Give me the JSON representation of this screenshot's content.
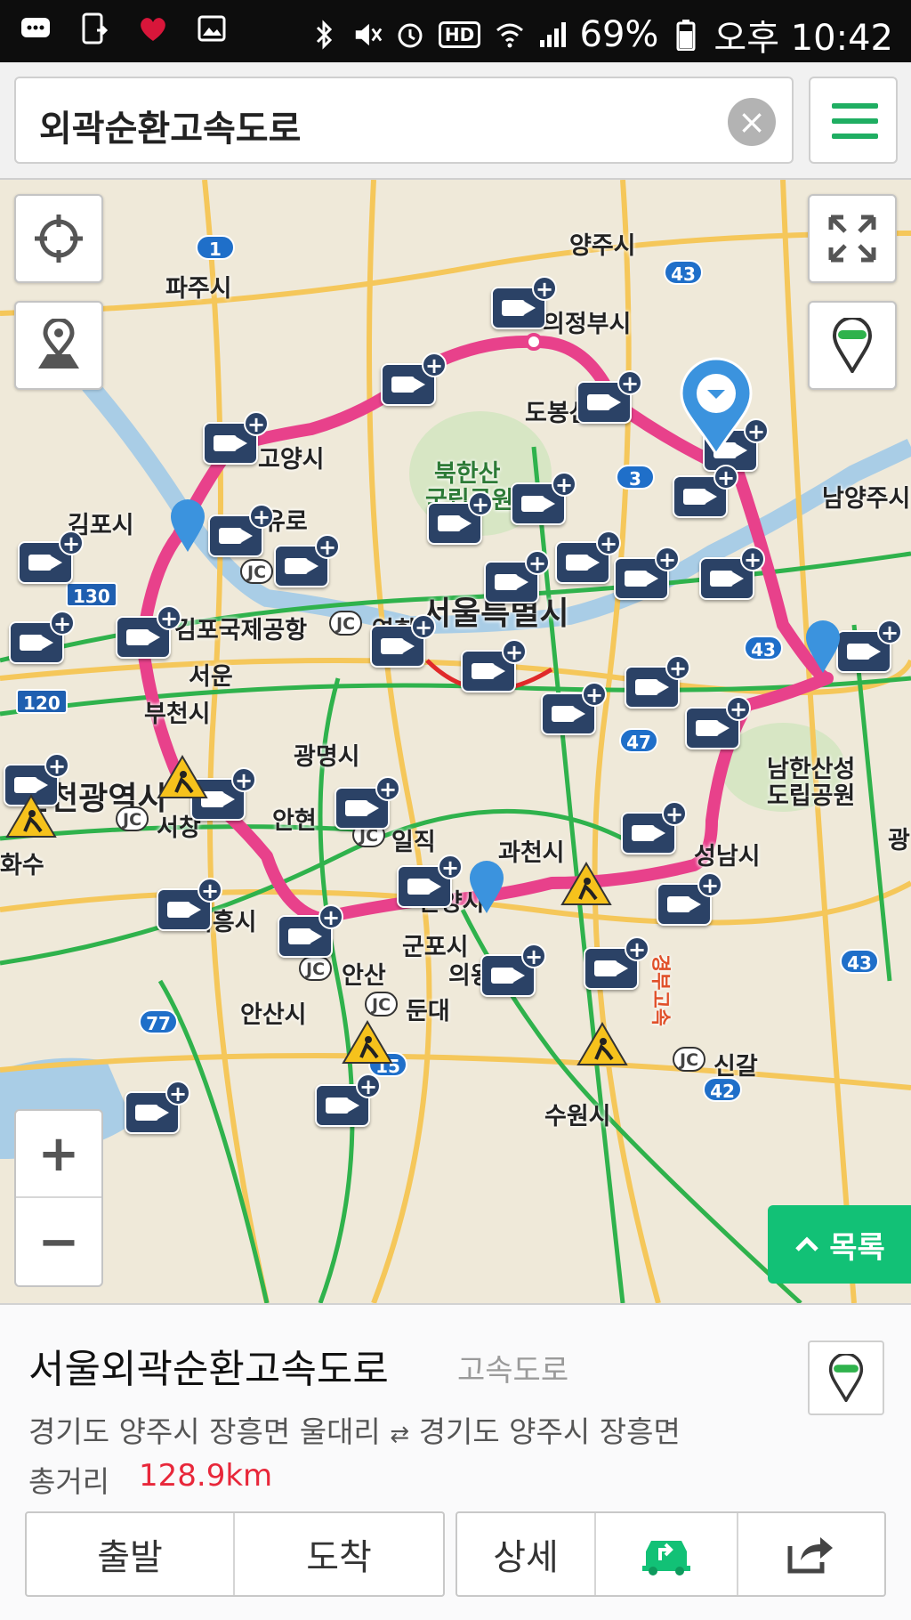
{
  "status_bar": {
    "left_icons": [
      "chat-icon",
      "phone-device-icon",
      "heart-icon",
      "image-icon"
    ],
    "right_icons": [
      "bluetooth-icon",
      "mute-icon",
      "alarm-icon",
      "hd-icon",
      "wifi-icon",
      "signal-icon"
    ],
    "hd_label": "HD",
    "battery": "69%",
    "time": "오후 10:42"
  },
  "search": {
    "query": "외곽순환고속도로",
    "clear_icon": "close-icon",
    "menu_icon": "hamburger-menu-icon"
  },
  "map": {
    "places": {
      "yangju": "양주시",
      "paju": "파주시",
      "uijeongbu": "의정부시",
      "dobong": "도봉산",
      "goyang": "고양시",
      "bukhansan": "북한산",
      "bukhansan2": "국립공원",
      "namyangju": "남양주시",
      "gimpo": "김포시",
      "yuro": "유로",
      "seoul": "서울특별시",
      "airport": "김포국제공항",
      "yeonhui": "연희",
      "seoun": "서운",
      "bucheon": "부천시",
      "gwangmyeong": "광명시",
      "namhansan": "남한산성",
      "namhansan2": "도립공원",
      "incheon": "인천광역시",
      "seochang": "서창",
      "anhyeon": "안현",
      "iljik": "일직",
      "gwacheon": "과천시",
      "seongnam": "성남시",
      "gwang": "광",
      "hwasu": "화수",
      "siheung": "시흥시",
      "anyang": "안양시",
      "gunpo": "군포시",
      "uiwang": "의왕",
      "ansan_jc": "안산",
      "dundae": "둔대",
      "ansan": "안산시",
      "singal": "신갈",
      "suwon": "수원시",
      "gyeongbu": "경부고속"
    },
    "shields": [
      "1",
      "43",
      "3",
      "130",
      "43",
      "120",
      "47",
      "43",
      "77",
      "15",
      "42"
    ],
    "jc_label": "JC",
    "list_button": "목록"
  },
  "panel": {
    "title": "서울외곽순환고속도로",
    "category": "고속도로",
    "route_from": "경기도 양주시 장흥면 울대리",
    "route_arrow": "⇄",
    "route_to": "경기도 양주시 장흥면",
    "distance_label": "총거리",
    "distance_value": "128.9km",
    "buttons": {
      "depart": "출발",
      "arrive": "도착",
      "detail": "상세",
      "route_icon": "car-route-icon",
      "share_icon": "share-icon"
    }
  },
  "colors": {
    "route": "#e8418b",
    "accent_green": "#12c176",
    "camera": "#2b4266",
    "distance": "#e8273a"
  }
}
